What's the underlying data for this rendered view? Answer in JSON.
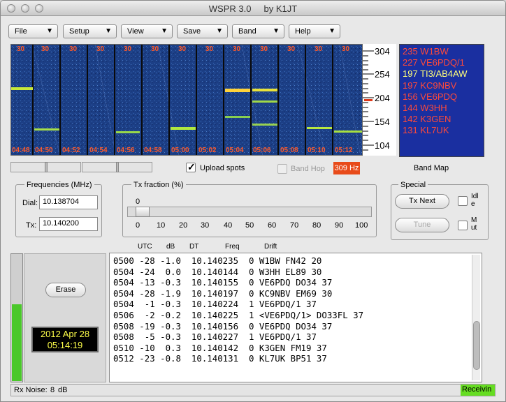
{
  "window": {
    "title": "WSPR 3.0     by K1JT"
  },
  "menubar": {
    "items": [
      "File",
      "Setup",
      "View",
      "Save",
      "Band",
      "Help"
    ]
  },
  "waterfall": {
    "top_labels": [
      "30",
      "30",
      "30",
      "30",
      "30",
      "30",
      "30",
      "30",
      "30",
      "30",
      "30",
      "30",
      "30"
    ],
    "time_labels": [
      "04:48",
      "04:50",
      "04:52",
      "04:54",
      "04:56",
      "04:58",
      "05:00",
      "05:02",
      "05:04",
      "05:06",
      "05:08",
      "05:10",
      "05:12"
    ],
    "scale_labels": [
      "304",
      "254",
      "204",
      "154",
      "104"
    ]
  },
  "callsign_list": [
    {
      "text": "235 W1BW",
      "color": "#ff4a3a"
    },
    {
      "text": "227 VE6PDQ/1",
      "color": "#ff4a3a"
    },
    {
      "text": "197 TI3/AB4AW",
      "color": "#ffff7a"
    },
    {
      "text": "197 KC9NBV",
      "color": "#ff4a3a"
    },
    {
      "text": "156 VE6PDQ",
      "color": "#ff4a3a"
    },
    {
      "text": "144 W3HH",
      "color": "#ff4a3a"
    },
    {
      "text": "142 K3GEN",
      "color": "#ff4a3a"
    },
    {
      "text": "131 KL7UK",
      "color": "#ff4a3a"
    }
  ],
  "controls": {
    "upload_spots_label": "Upload spots",
    "upload_spots_checked": true,
    "band_hop_label": "Band Hop",
    "band_hop_checked": false,
    "freq_offset": "309 Hz",
    "band_map_label": "Band Map"
  },
  "frequencies": {
    "title": "Frequencies (MHz)",
    "dial_label": "Dial:",
    "dial_value": "10.138704",
    "tx_label": "Tx:",
    "tx_value": "10.140200"
  },
  "tx_fraction": {
    "title": "Tx fraction (%)",
    "current_value": "0",
    "ticks": [
      "0",
      "10",
      "20",
      "30",
      "40",
      "50",
      "60",
      "70",
      "80",
      "90",
      "100"
    ]
  },
  "special": {
    "title": "Special",
    "tx_next_label": "Tx Next",
    "tune_label": "Tune",
    "idle_label": "Idl\ne",
    "mute_label": "M\nut"
  },
  "decode_headers": [
    "UTC",
    "dB",
    "DT",
    "Freq",
    "Drift"
  ],
  "decodes": [
    "0500 -28 -1.0  10.140235  0 W1BW FN42 20",
    "0504 -24  0.0  10.140144  0 W3HH EL89 30",
    "0504 -13 -0.3  10.140155  0 VE6PDQ DO34 37",
    "0504 -28 -1.9  10.140197  0 KC9NBV EM69 30",
    "0504  -1 -0.3  10.140224  1 VE6PDQ/1 37",
    "0506  -2 -0.2  10.140225  1 <VE6PDQ/1> DO33FL 37",
    "0508 -19 -0.3  10.140156  0 VE6PDQ DO34 37",
    "0508  -5 -0.3  10.140227  1 VE6PDQ/1 37",
    "0510 -10  0.3  10.140142  0 K3GEN FM19 37",
    "0512 -23 -0.8  10.140131  0 KL7UK BP51 37"
  ],
  "left_panel": {
    "erase_label": "Erase",
    "date": "2012 Apr 28",
    "time": "05:14:19"
  },
  "status": {
    "rx_noise_label": "Rx Noise:",
    "rx_noise_value": "8",
    "rx_noise_unit": "dB",
    "state": "Receivin",
    "state_color": "#66dd22"
  },
  "colors": {
    "waterfall_bg": "#1c3f86",
    "signal": "#c8ff3c",
    "accent": "#ff4a3a",
    "offset_box": "#e84b1a"
  }
}
